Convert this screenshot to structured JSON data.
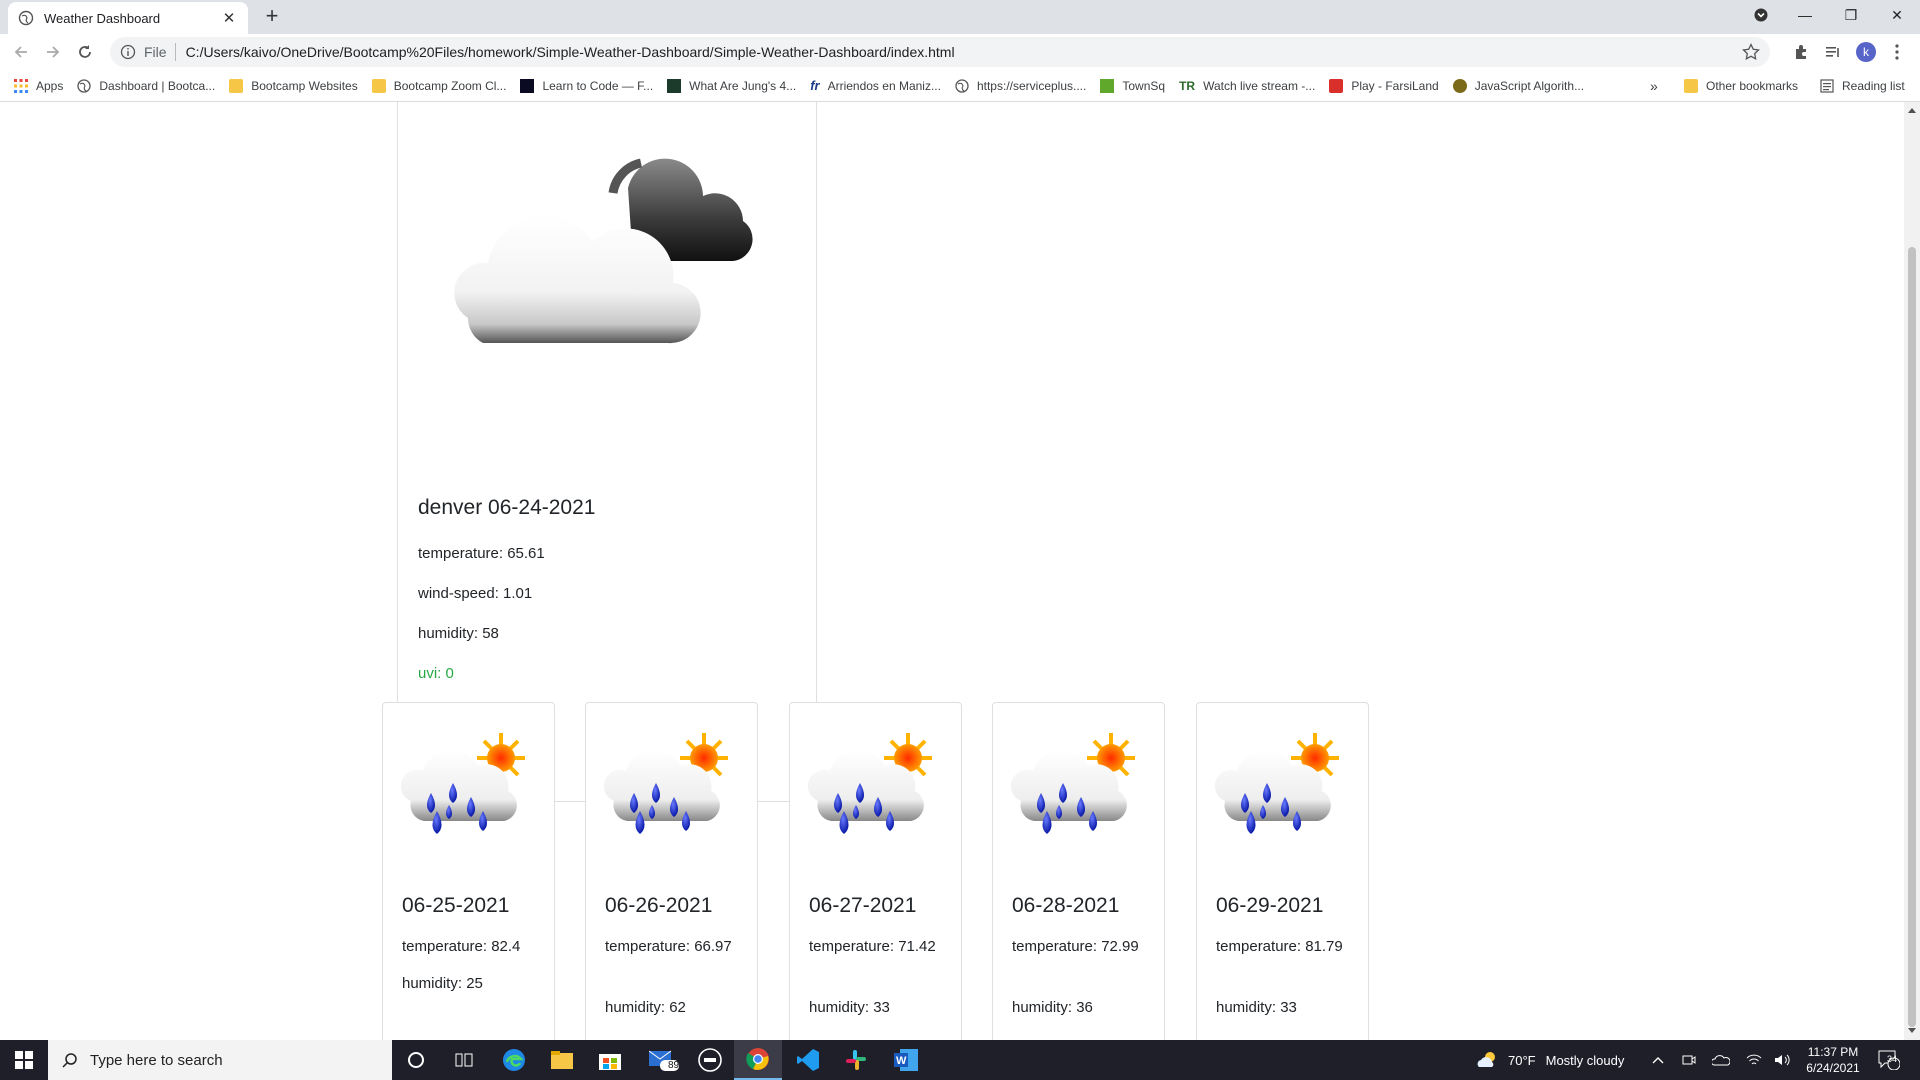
{
  "browser": {
    "tab_title": "Weather Dashboard",
    "scheme": "File",
    "url": "C:/Users/kaivo/OneDrive/Bootcamp%20Files/homework/Simple-Weather-Dashboard/Simple-Weather-Dashboard/index.html",
    "profile_initial": "k"
  },
  "bookmarks": {
    "items": [
      {
        "label": "Apps",
        "icon": "apps-grid-icon"
      },
      {
        "label": "Dashboard | Bootca...",
        "icon": "globe-icon"
      },
      {
        "label": "Bootcamp Websites",
        "icon": "folder-icon"
      },
      {
        "label": "Bootcamp Zoom Cl...",
        "icon": "folder-icon"
      },
      {
        "label": "Learn to Code — F...",
        "icon": "freecodecamp-icon"
      },
      {
        "label": "What Are Jung's 4...",
        "icon": "site-icon"
      },
      {
        "label": "Arriendos en Maniz...",
        "icon": "fr-icon"
      },
      {
        "label": "https://serviceplus....",
        "icon": "globe-icon"
      },
      {
        "label": "TownSq",
        "icon": "townsq-icon"
      },
      {
        "label": "Watch live stream -...",
        "icon": "tr-icon"
      },
      {
        "label": "Play - FarsiLand",
        "icon": "farsiland-icon"
      },
      {
        "label": "JavaScript Algorith...",
        "icon": "freecodecamp-icon"
      }
    ],
    "more": "»",
    "other": "Other bookmarks",
    "reading_list": "Reading list"
  },
  "current": {
    "heading": "denver 06-24-2021",
    "temperature": "temperature: 65.61",
    "wind_speed": "wind-speed: 1.01",
    "humidity": "humidity: 58",
    "uvi": "uvi: 0",
    "uvi_color": "#28a745",
    "icon": "cloudy-night-icon"
  },
  "forecast": [
    {
      "date": "06-25-2021",
      "temperature": "temperature: 82.4",
      "humidity": "humidity: 25",
      "icon": "rain-sun-icon"
    },
    {
      "date": "06-26-2021",
      "temperature": "temperature: 66.97",
      "humidity": "humidity: 62",
      "icon": "rain-sun-icon"
    },
    {
      "date": "06-27-2021",
      "temperature": "temperature: 71.42",
      "humidity": "humidity: 33",
      "icon": "rain-sun-icon"
    },
    {
      "date": "06-28-2021",
      "temperature": "temperature: 72.99",
      "humidity": "humidity: 36",
      "icon": "rain-sun-icon"
    },
    {
      "date": "06-29-2021",
      "temperature": "temperature: 81.79",
      "humidity": "humidity: 33",
      "icon": "rain-sun-icon"
    }
  ],
  "taskbar": {
    "search_placeholder": "Type here to search",
    "mail_badge": "89",
    "weather_temp": "70°F",
    "weather_text": "Mostly cloudy",
    "time": "11:37 PM",
    "date": "6/24/2021",
    "notification_count": "34"
  }
}
